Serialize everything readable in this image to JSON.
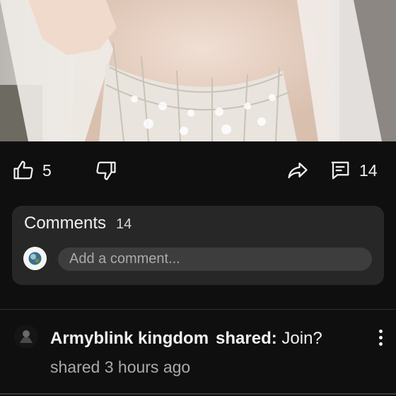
{
  "media": {
    "kind": "video-frame"
  },
  "actions": {
    "like_icon": "thumbs-up-icon",
    "like_count": "5",
    "dislike_icon": "thumbs-down-icon",
    "share_icon": "share-arrow-icon",
    "comments_icon": "comment-icon",
    "comments_count": "14"
  },
  "comments": {
    "title": "Comments",
    "count": "14",
    "input_placeholder": "Add a comment..."
  },
  "activity": {
    "user": "Armyblink kingdom",
    "verb": "shared:",
    "message": "Join?",
    "time": "shared 3 hours ago"
  },
  "colors": {
    "background": "#0f0f0f",
    "panel": "#272727",
    "input": "#3d3d3d",
    "text": "#f1f1f1",
    "muted": "#aaaaaa"
  }
}
